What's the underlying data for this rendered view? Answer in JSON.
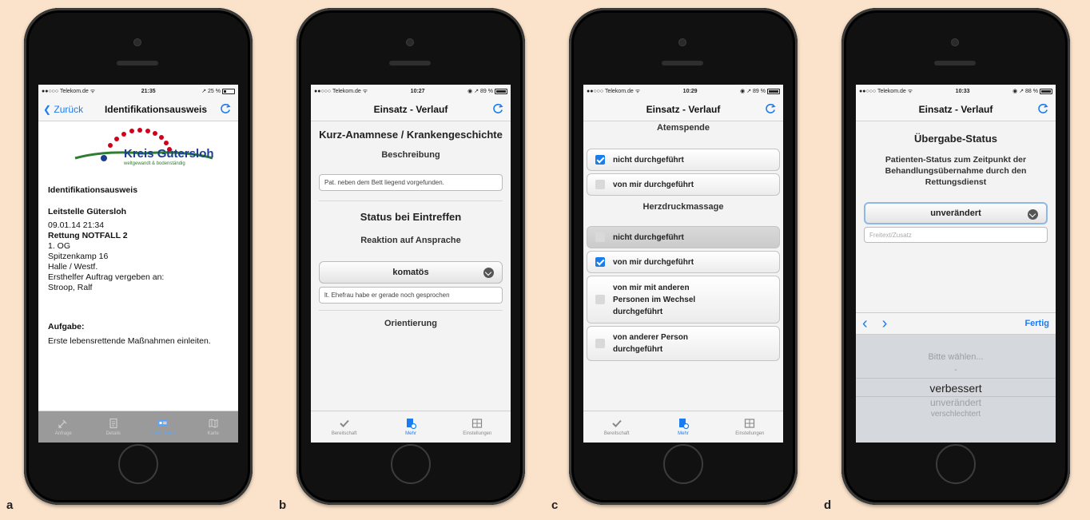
{
  "panels": {
    "a": {
      "letter": "a",
      "status": {
        "carrier": "●●○○○ Telekom.de ᯤ",
        "time": "21:35",
        "right": "↗ 25 %"
      },
      "nav": {
        "back": "❮ Zurück",
        "title": "Identifikationsausweis"
      },
      "logo_text": "Kreis Gütersloh",
      "logo_tagline": "weltgewandt & bodenständig",
      "heading": "Identifikationsausweis",
      "org": "Leitstelle Gütersloh",
      "datetime": "09.01.14 21:34",
      "event": "Rettung NOTFALL 2",
      "lines": [
        "1. OG",
        "Spitzenkamp 16",
        "Halle / Westf.",
        "Ersthelfer Auftrag vergeben an:",
        "Stroop, Ralf"
      ],
      "task_label": "Aufgabe:",
      "task_text": "Erste lebensrettende Maßnahmen einleiten.",
      "tabs": [
        "Anfrage",
        "Details",
        "ID-Ausweis",
        "Karte"
      ]
    },
    "b": {
      "letter": "b",
      "status": {
        "carrier": "●●○○○ Telekom.de ᯤ",
        "time": "10:27",
        "right": "◉ ↗ 89 %"
      },
      "nav": {
        "title": "Einsatz - Verlauf"
      },
      "section1": "Kurz-Anamnese / Krankengeschichte",
      "label1": "Beschreibung",
      "field1": "Pat. neben dem Bett liegend vorgefunden.",
      "section2": "Status bei Eintreffen",
      "label2": "Reaktion auf Ansprache",
      "select": "komatös",
      "field2": "lt. Ehefrau habe er gerade noch gesprochen",
      "label3": "Orientierung",
      "tabs": [
        "Bereitschaft",
        "Mehr",
        "Einstellungen"
      ]
    },
    "c": {
      "letter": "c",
      "status": {
        "carrier": "●●○○○ Telekom.de ᯤ",
        "time": "10:29",
        "right": "◉ ↗ 89 %"
      },
      "nav": {
        "title": "Einsatz - Verlauf"
      },
      "header1": "Atemspende",
      "group1": [
        {
          "label": "nicht durchgeführt",
          "checked": true
        },
        {
          "label": "von mir durchgeführt",
          "checked": false
        }
      ],
      "header2": "Herzdruckmassage",
      "group2": [
        {
          "label": "nicht durchgeführt",
          "checked": false
        },
        {
          "label": "von mir durchgeführt",
          "checked": true
        },
        {
          "label": "von mir mit anderen Personen im Wechsel durchgeführt",
          "checked": false
        },
        {
          "label": "von anderer Person durchgeführt",
          "checked": false
        }
      ],
      "tabs": [
        "Bereitschaft",
        "Mehr",
        "Einstellungen"
      ]
    },
    "d": {
      "letter": "d",
      "status": {
        "carrier": "●●○○○ Telekom.de ᯤ",
        "time": "10:33",
        "right": "◉ ↗ 88 %"
      },
      "nav": {
        "title": "Einsatz - Verlauf"
      },
      "section": "Übergabe-Status",
      "description": "Patienten-Status zum Zeitpunkt der Behandlungsübernahme durch den Rettungsdienst",
      "select": "unverändert",
      "field_placeholder": "Freitext/Zusatz",
      "toolbar": {
        "prev": "‹",
        "next": "›",
        "done": "Fertig"
      },
      "picker": [
        "Bitte wählen...",
        "-",
        "verbessert",
        "unverändert",
        "verschlechtert"
      ],
      "picker_selected": "verbessert"
    }
  },
  "colors": {
    "background": "#fbe3cb",
    "accent": "#1a7cf0",
    "phone": "#111111"
  }
}
